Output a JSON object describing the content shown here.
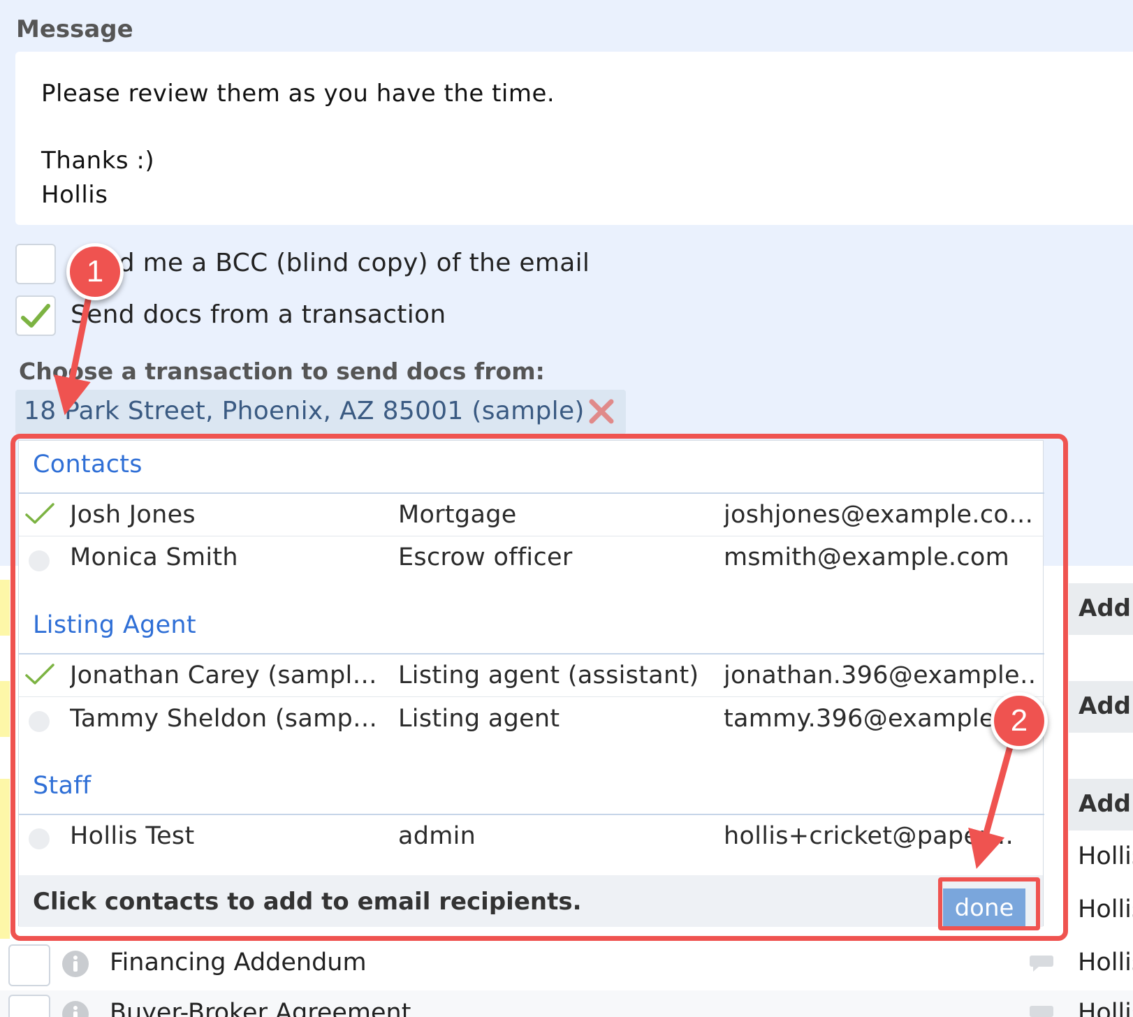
{
  "message": {
    "label": "Message",
    "lines": [
      "Please review them as you have the time.",
      "Thanks :)",
      "Hollis"
    ]
  },
  "options": {
    "bcc_label": "Send me a BCC (blind copy) of the email",
    "bcc_checked": false,
    "send_docs_label": "Send docs from a transaction",
    "send_docs_checked": true
  },
  "transaction": {
    "label": "Choose a transaction to send docs from:",
    "selected": "18 Park Street, Phoenix, AZ 85001 (sample)"
  },
  "popup": {
    "sections": [
      {
        "title": "Contacts",
        "rows": [
          {
            "name": "Josh Jones",
            "role": "Mortgage",
            "email": "joshjones@example.co…",
            "selected": true
          },
          {
            "name": "Monica Smith",
            "role": "Escrow officer",
            "email": "msmith@example.com",
            "selected": false
          }
        ]
      },
      {
        "title": "Listing Agent",
        "rows": [
          {
            "name": "Jonathan Carey (sampl…",
            "role": "Listing agent (assistant)",
            "email": "jonathan.396@example…",
            "selected": true
          },
          {
            "name": "Tammy Sheldon (samp…",
            "role": "Listing agent",
            "email": "tammy.396@example…",
            "selected": false
          }
        ]
      },
      {
        "title": "Staff",
        "rows": [
          {
            "name": "Hollis Test",
            "role": "admin",
            "email": "hollis+cricket@paper…",
            "selected": false
          }
        ]
      }
    ],
    "footer_text": "Click contacts to add to email recipients.",
    "done_label": "done"
  },
  "background": {
    "add_label": "Add",
    "owner": "Hollis",
    "docs": [
      "Financing Addendum",
      "Buyer-Broker Agreement"
    ]
  },
  "annotations": {
    "step1": "1",
    "step2": "2"
  },
  "colors": {
    "accent_blue": "#2f6fd6",
    "annotation_red": "#ef5350",
    "check_green": "#7cb342",
    "done_button": "#7aa6dc"
  }
}
